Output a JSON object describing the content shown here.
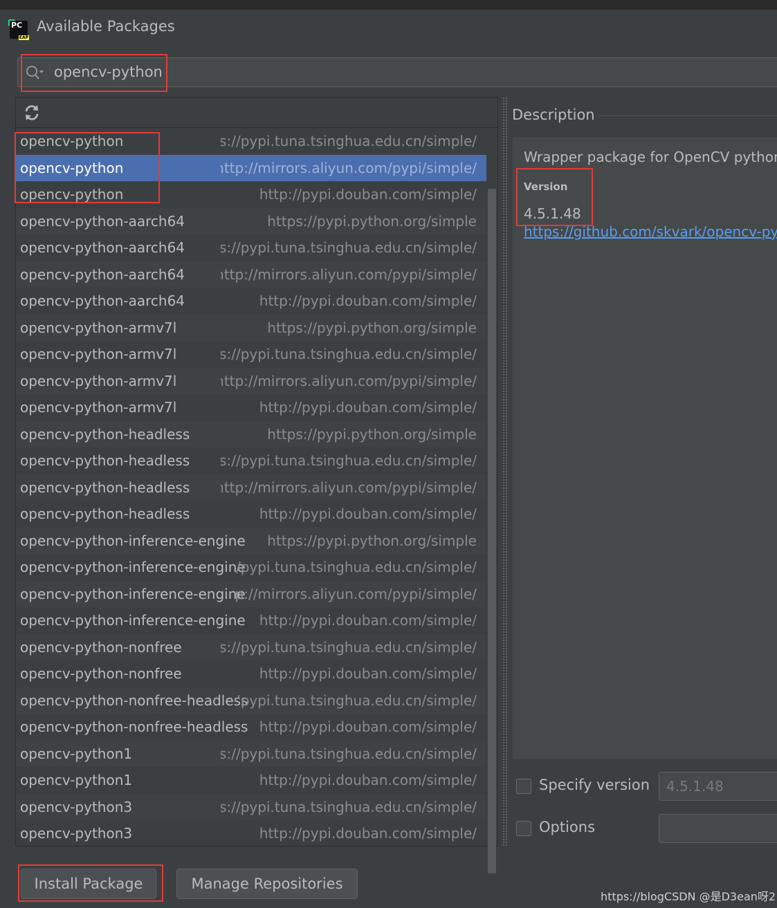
{
  "window": {
    "title": "Available Packages",
    "app_icon_letters": "PC",
    "app_icon_badge": "EAP"
  },
  "search": {
    "value": "opencv-python"
  },
  "packages": [
    {
      "name": "opencv-python",
      "repo": "https://pypi.tuna.tsinghua.edu.cn/simple/"
    },
    {
      "name": "opencv-python",
      "repo": "http://mirrors.aliyun.com/pypi/simple/",
      "selected": true
    },
    {
      "name": "opencv-python",
      "repo": "http://pypi.douban.com/simple/"
    },
    {
      "name": "opencv-python-aarch64",
      "repo": "https://pypi.python.org/simple"
    },
    {
      "name": "opencv-python-aarch64",
      "repo": "https://pypi.tuna.tsinghua.edu.cn/simple/"
    },
    {
      "name": "opencv-python-aarch64",
      "repo": "http://mirrors.aliyun.com/pypi/simple/"
    },
    {
      "name": "opencv-python-aarch64",
      "repo": "http://pypi.douban.com/simple/"
    },
    {
      "name": "opencv-python-armv7l",
      "repo": "https://pypi.python.org/simple"
    },
    {
      "name": "opencv-python-armv7l",
      "repo": "https://pypi.tuna.tsinghua.edu.cn/simple/"
    },
    {
      "name": "opencv-python-armv7l",
      "repo": "http://mirrors.aliyun.com/pypi/simple/"
    },
    {
      "name": "opencv-python-armv7l",
      "repo": "http://pypi.douban.com/simple/"
    },
    {
      "name": "opencv-python-headless",
      "repo": "https://pypi.python.org/simple"
    },
    {
      "name": "opencv-python-headless",
      "repo": "https://pypi.tuna.tsinghua.edu.cn/simple/"
    },
    {
      "name": "opencv-python-headless",
      "repo": "http://mirrors.aliyun.com/pypi/simple/"
    },
    {
      "name": "opencv-python-headless",
      "repo": "http://pypi.douban.com/simple/"
    },
    {
      "name": "opencv-python-inference-engine",
      "repo": "https://pypi.python.org/simple"
    },
    {
      "name": "opencv-python-inference-engine",
      "repo": "/pypi.tuna.tsinghua.edu.cn/simple/"
    },
    {
      "name": "opencv-python-inference-engine",
      "repo": "p://mirrors.aliyun.com/pypi/simple/"
    },
    {
      "name": "opencv-python-inference-engine",
      "repo": "http://pypi.douban.com/simple/"
    },
    {
      "name": "opencv-python-nonfree",
      "repo": "https://pypi.tuna.tsinghua.edu.cn/simple/"
    },
    {
      "name": "opencv-python-nonfree",
      "repo": "http://pypi.douban.com/simple/"
    },
    {
      "name": "opencv-python-nonfree-headless",
      "repo": "'pypi.tuna.tsinghua.edu.cn/simple/"
    },
    {
      "name": "opencv-python-nonfree-headless",
      "repo": "http://pypi.douban.com/simple/"
    },
    {
      "name": "opencv-python1",
      "repo": "https://pypi.tuna.tsinghua.edu.cn/simple/"
    },
    {
      "name": "opencv-python1",
      "repo": "http://pypi.douban.com/simple/"
    },
    {
      "name": "opencv-python3",
      "repo": "https://pypi.tuna.tsinghua.edu.cn/simple/"
    },
    {
      "name": "opencv-python3",
      "repo": "http://pypi.douban.com/simple/"
    }
  ],
  "description": {
    "heading": "Description",
    "text": "Wrapper package for OpenCV python b",
    "version_label": "Version",
    "version_value": "4.5.1.48",
    "link": "https://github.com/skvark/opencv-python"
  },
  "options": {
    "specify_version_label": "Specify version",
    "specify_version_value": "4.5.1.48",
    "options_label": "Options",
    "options_value": ""
  },
  "buttons": {
    "install": "Install Package",
    "manage": "Manage Repositories"
  },
  "watermark": "https://blogCSDN @是D3ean呀2",
  "colors": {
    "selection": "#4b6eaf",
    "link": "#589df6",
    "highlight_box": "#e03c3c"
  }
}
